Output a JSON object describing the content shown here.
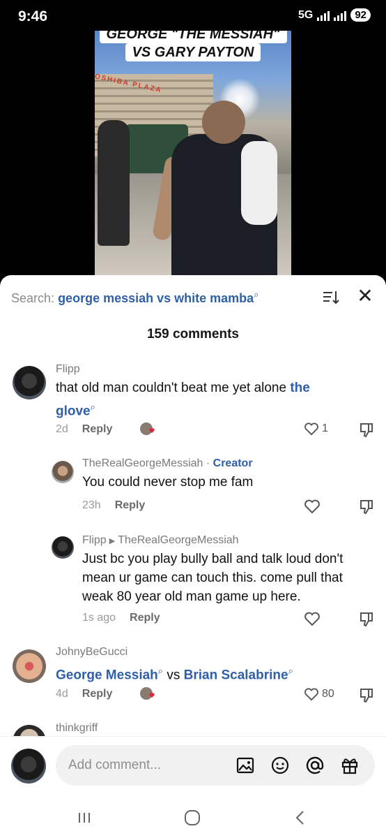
{
  "status_bar": {
    "time": "9:46",
    "network": "5G",
    "battery": "92"
  },
  "video": {
    "caption_line1": "GEORGE \"THE MESSIAH\"",
    "caption_line2": "VS GARY PAYTON",
    "sign_text": "OSHIBA PLAZA"
  },
  "search": {
    "prefix": "Search:",
    "query": "george messiah vs white mamba",
    "sort_icon": "sort-icon",
    "close_icon": "close-icon"
  },
  "comments_header": {
    "count_label": "159 comments"
  },
  "comments": [
    {
      "user": "Flipp",
      "text_plain": "that old man couldn't beat me yet alone ",
      "text_link": "the glove",
      "time": "2d",
      "reply_label": "Reply",
      "likes": "1"
    },
    {
      "user": "TheRealGeorgeMessiah",
      "badge_sep": " · ",
      "badge": "Creator",
      "text": "You could never stop me fam",
      "time": "23h",
      "reply_label": "Reply"
    },
    {
      "user": "Flipp",
      "reply_to": "TheRealGeorgeMessiah",
      "text": "Just bc you play bully ball and talk loud don't mean ur game can touch this. come pull that weak 80 year old man game up here.",
      "time": "1s ago",
      "reply_label": "Reply"
    },
    {
      "user": "JohnyBeGucci",
      "link1": "George Messiah",
      "middle": " vs ",
      "link2": "Brian Scalabrine",
      "time": "4d",
      "reply_label": "Reply",
      "likes": "80"
    },
    {
      "user": "thinkgriff"
    }
  ],
  "composer": {
    "placeholder": "Add comment..."
  },
  "icons": [
    "search-icon",
    "sort-icon",
    "close-icon",
    "heart-icon",
    "dislike-icon",
    "image-icon",
    "emoji-icon",
    "mention-icon",
    "gift-icon",
    "recent-apps-icon",
    "home-icon",
    "back-icon"
  ]
}
